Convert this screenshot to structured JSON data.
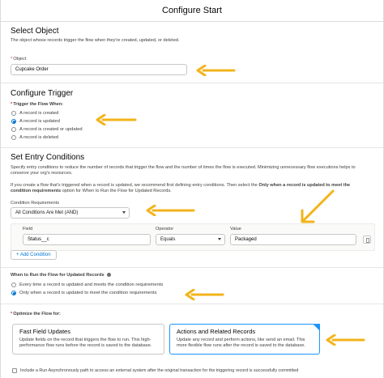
{
  "header": {
    "title": "Configure Start"
  },
  "select_object": {
    "title": "Select Object",
    "help": "The object whose records trigger the flow when they're created, updated, or deleted.",
    "object_label": "Object",
    "object_value": "Cupcake Order"
  },
  "configure_trigger": {
    "title": "Configure Trigger",
    "trigger_label": "Trigger the Flow When:",
    "options": [
      {
        "label": "A record is created",
        "selected": false
      },
      {
        "label": "A record is updated",
        "selected": true
      },
      {
        "label": "A record is created or updated",
        "selected": false
      },
      {
        "label": "A record is deleted",
        "selected": false
      }
    ]
  },
  "entry_conditions": {
    "title": "Set Entry Conditions",
    "help1": "Specify entry conditions to reduce the number of records that trigger the flow and the number of times the flow is executed. Minimizing unnecessary flow executions helps to conserve your org's resources.",
    "help2_prefix": "If you create a flow that's triggered when a record is updated, we recommend first defining entry conditions. Then select the ",
    "help2_bold": "Only when a record is updated to meet the condition requirements",
    "help2_suffix": " option for When to Run the Flow for Updated Records.",
    "requirements_label": "Condition Requirements",
    "requirements_value": "All Conditions Are Met (AND)",
    "field_label": "Field",
    "field_value": "Status__c",
    "operator_label": "Operator",
    "operator_value": "Equals",
    "value_label": "Value",
    "value_value": "Packaged",
    "add_condition": "+ Add Condition"
  },
  "run_flow": {
    "title": "When to Run the Flow for Updated Records",
    "options": [
      {
        "label": "Every time a record is updated and meets the condition requirements",
        "selected": false
      },
      {
        "label": "Only when a record is updated to meet the condition requirements",
        "selected": true
      }
    ]
  },
  "optimize": {
    "label": "Optimize the Flow for:",
    "cards": [
      {
        "title": "Fast Field Updates",
        "desc": "Update fields on the record that triggers the flow to run. This high-performance flow runs before the record is saved to the database.",
        "selected": false
      },
      {
        "title": "Actions and Related Records",
        "desc": "Update any record and perform actions, like send an email. This more flexible flow runs after the record is saved to the database.",
        "selected": true
      }
    ],
    "async_label": "Include a Run Asynchronously path to access an external system after the original transaction for the triggering record is successfully committed"
  },
  "colors": {
    "accent": "#0176d3",
    "arrow": "#f2b41b",
    "required": "#c23934"
  }
}
